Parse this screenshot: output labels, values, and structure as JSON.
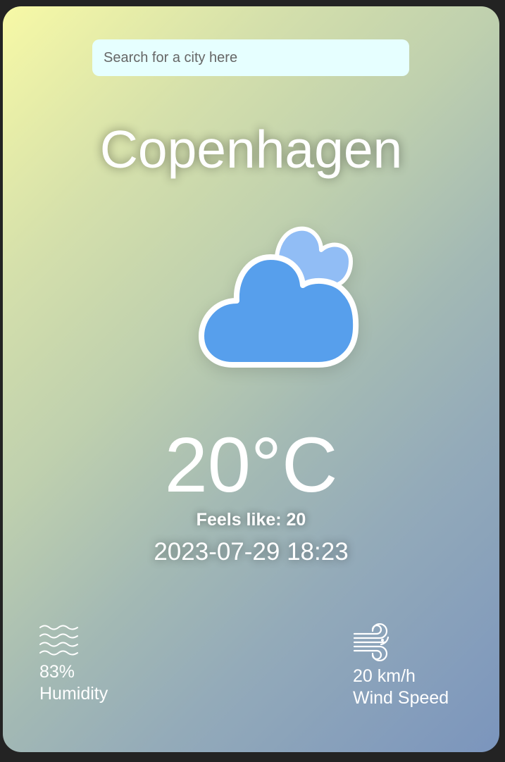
{
  "search": {
    "placeholder": "Search for a city here",
    "value": ""
  },
  "weather": {
    "city": "Copenhagen",
    "icon": "partly-cloudy-icon",
    "temperature": "20°C",
    "feels_like": "Feels like: 20",
    "datetime": "2023-07-29 18:23"
  },
  "stats": {
    "humidity": {
      "icon": "humidity-waves-icon",
      "value": "83%",
      "label": "Humidity"
    },
    "wind": {
      "icon": "wind-icon",
      "value": "20 km/h",
      "label": "Wind Speed"
    }
  },
  "colors": {
    "cloud_front": "#579fec",
    "cloud_back": "#91bdf5",
    "search_bg": "#e6ffff",
    "gradient_start": "#f7f9a6",
    "gradient_end": "#7b95bd"
  }
}
